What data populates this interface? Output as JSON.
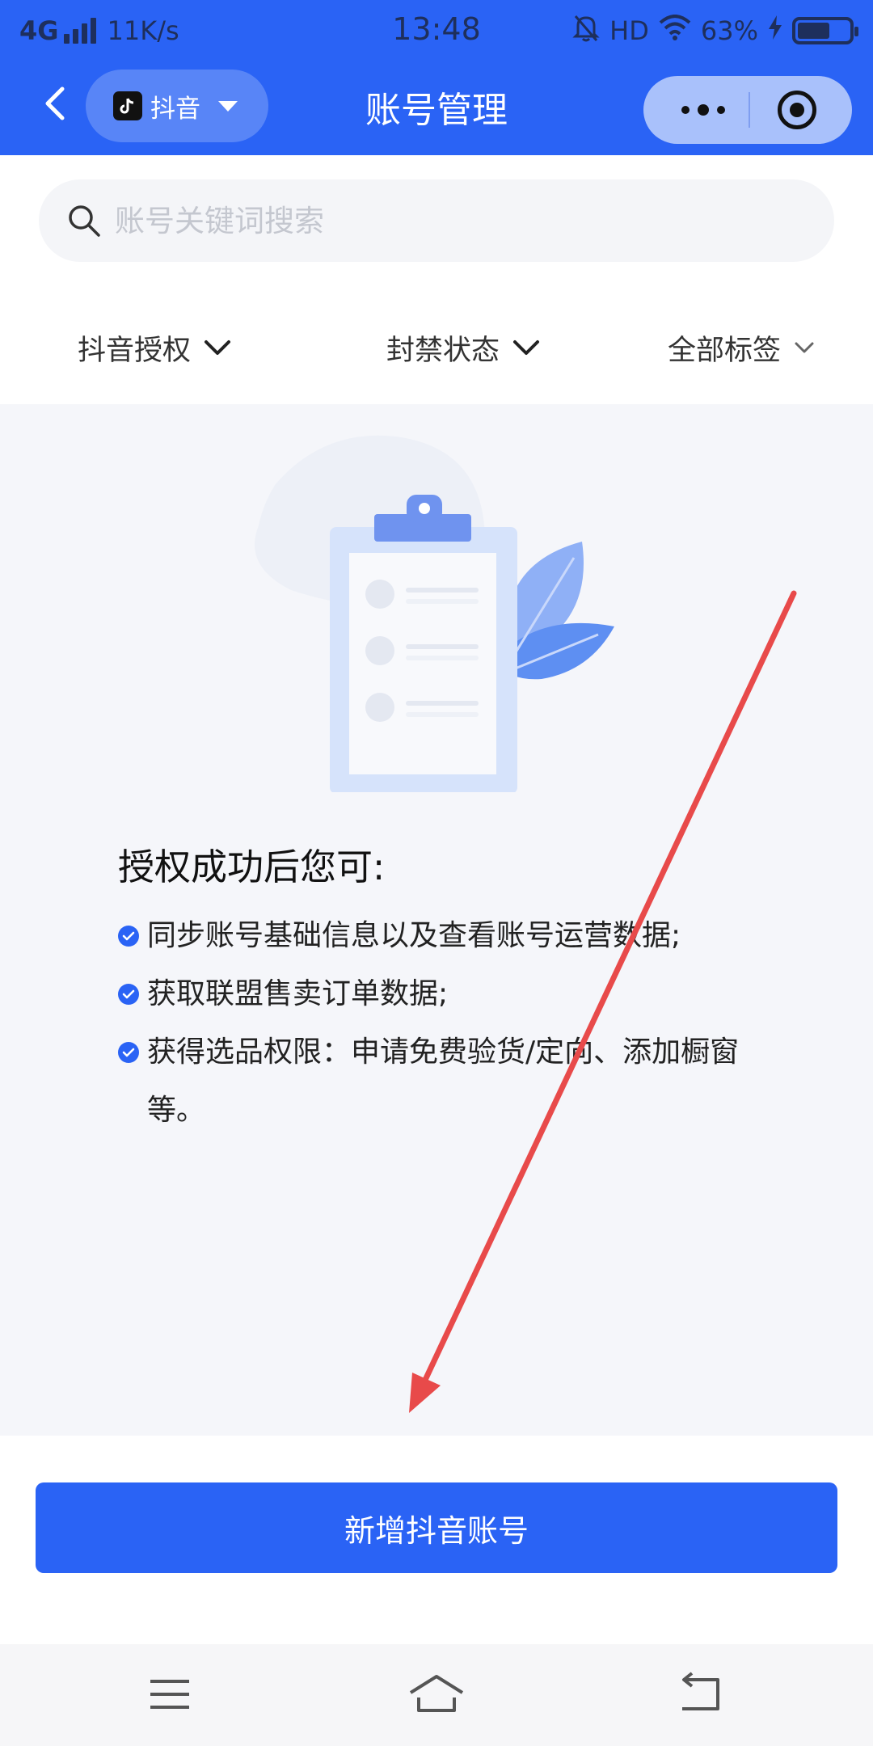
{
  "status_bar": {
    "network": "4G",
    "speed": "11K/s",
    "time": "13:48",
    "hd": "HD",
    "battery": "63%",
    "battery_level": 0.63
  },
  "header": {
    "platform": "抖音",
    "title": "账号管理"
  },
  "search": {
    "placeholder": "账号关键词搜索"
  },
  "filters": [
    {
      "label": "抖音授权"
    },
    {
      "label": "封禁状态"
    },
    {
      "label": "全部标签"
    }
  ],
  "info": {
    "title": "授权成功后您可:",
    "items": [
      "同步账号基础信息以及查看账号运营数据;",
      "获取联盟售卖订单数据;",
      "获得选品权限：申请免费验货/定向、添加橱窗等。"
    ]
  },
  "action": {
    "add_label": "新增抖音账号"
  },
  "colors": {
    "primary": "#2a63f5",
    "background": "#f5f6fa",
    "annotation": "#e84a4a"
  }
}
